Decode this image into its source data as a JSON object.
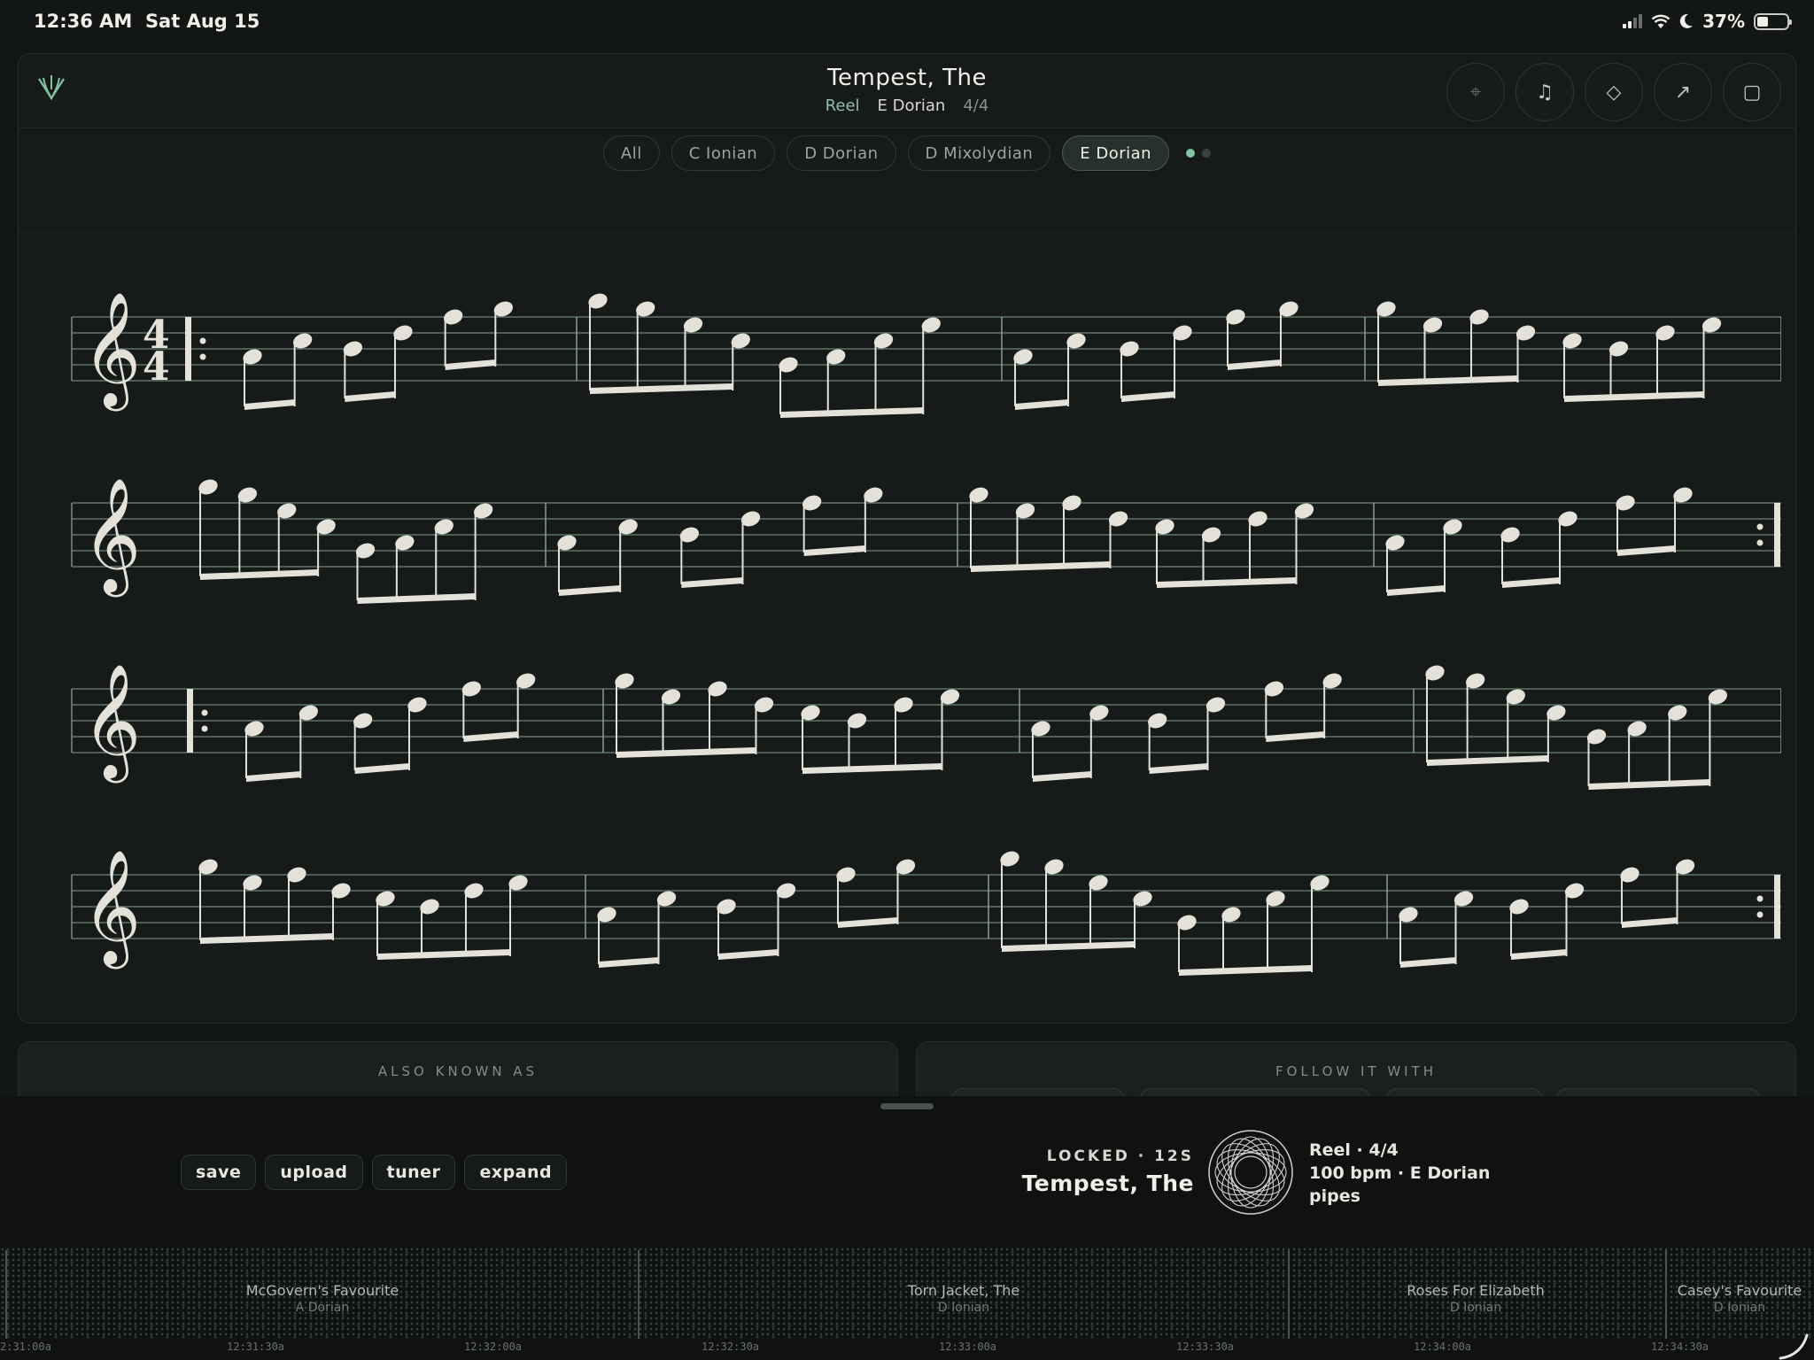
{
  "status_bar": {
    "time": "12:36 AM",
    "date": "Sat Aug 15",
    "battery": "37%",
    "battery_level": 0.37
  },
  "tune": {
    "title": "Tempest, The",
    "type": "Reel",
    "key": "E Dorian",
    "time_signature": "4/4"
  },
  "toolbar": {
    "buttons": [
      {
        "icon": "crosshair-icon"
      },
      {
        "icon": "music-note-icon"
      },
      {
        "icon": "diamond-icon"
      },
      {
        "icon": "arrow-up-right-icon"
      },
      {
        "icon": "square-icon"
      }
    ]
  },
  "mode_filters": {
    "items": [
      "All",
      "C Ionian",
      "D Dorian",
      "D Mixolydian",
      "E Dorian"
    ],
    "selected": "E Dorian",
    "page_dots": 2,
    "active_page": 1
  },
  "score": {
    "clef": "treble",
    "time_signature_top": "4",
    "time_signature_bottom": "4",
    "systems": 4
  },
  "panels": {
    "also_known_as": {
      "label": "ALSO KNOWN AS"
    },
    "follow_it_with": {
      "label": "FOLLOW IT WITH"
    }
  },
  "actions": [
    "save",
    "upload",
    "tuner",
    "expand"
  ],
  "lock": {
    "state": "LOCKED · 12S",
    "title": "Tempest, The"
  },
  "info": {
    "line1": "Reel · 4/4",
    "line2": "100 bpm · E Dorian",
    "line3": "pipes"
  },
  "timeline": {
    "segments": [
      {
        "title": "McGovern's Favourite",
        "key": "A Dorian"
      },
      {
        "title": "Torn Jacket, The",
        "key": "D Ionian"
      },
      {
        "title": "Roses For Elizabeth",
        "key": "D Ionian"
      },
      {
        "title": "Casey's Favourite",
        "key": "D Ionian"
      }
    ],
    "ticks": [
      "2:31:00a",
      "12:31:30a",
      "12:32:00a",
      "12:32:30a",
      "12:33:00a",
      "12:33:30a",
      "12:34:00a",
      "12:34:30a"
    ]
  },
  "colors": {
    "background": "#121614",
    "accent": "#7fc3a3",
    "notes": "#e4e1d8",
    "staff": "#8fa89b"
  }
}
